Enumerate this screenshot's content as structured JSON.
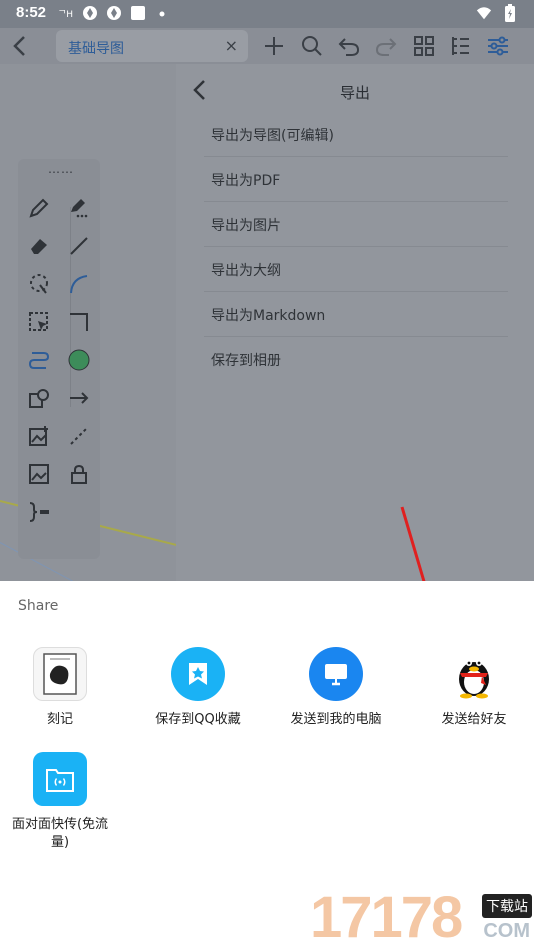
{
  "status_bar": {
    "time": "8:52",
    "left_icons": [
      "carrier-icon",
      "sync-icon",
      "sync-icon",
      "square-icon",
      "dot-icon"
    ],
    "right_icons": [
      "wifi-icon",
      "battery-icon"
    ]
  },
  "toolbar": {
    "tab_title": "基础导图",
    "tab_close": "×",
    "icons": [
      "back-icon",
      "add-icon",
      "search-icon",
      "undo-icon",
      "redo-icon",
      "grid-icon",
      "outline-icon",
      "settings-sliders-icon"
    ]
  },
  "palette": {
    "grip": "⋯⋯",
    "tools": [
      "pencil-icon",
      "pen-dots-icon",
      "eraser-icon",
      "line-icon",
      "lasso-icon",
      "arc-icon",
      "select-box-icon",
      "corner-icon",
      "connector-icon",
      "circle-fill-icon",
      "shape-icon",
      "arrow-icon",
      "image-add-icon",
      "dashed-line-icon",
      "image-icon",
      "lock-icon",
      "bracket-icon"
    ],
    "circle_color": "#3d8c5a"
  },
  "export_panel": {
    "title": "导出",
    "items": [
      {
        "label": "导出为导图(可编辑)"
      },
      {
        "label": "导出为PDF"
      },
      {
        "label": "导出为图片"
      },
      {
        "label": "导出为大纲"
      },
      {
        "label": "导出为Markdown"
      },
      {
        "label": "保存到相册"
      }
    ]
  },
  "share_sheet": {
    "title": "Share",
    "apps": [
      {
        "label": "刻记",
        "icon": "keji-app-icon"
      },
      {
        "label": "保存到QQ收藏",
        "icon": "qq-favorites-icon"
      },
      {
        "label": "发送到我的电脑",
        "icon": "my-computer-icon"
      },
      {
        "label": "发送给好友",
        "icon": "qq-penguin-icon"
      },
      {
        "label": "面对面快传(免流量)",
        "icon": "face-transfer-icon"
      }
    ]
  },
  "colors": {
    "qq_blue": "#1ab2f5",
    "arrow_red": "#e02020",
    "overlay": "#8c9098"
  },
  "watermark": {
    "digits": "17178",
    "badge": "下载站",
    "domain": "COM"
  }
}
